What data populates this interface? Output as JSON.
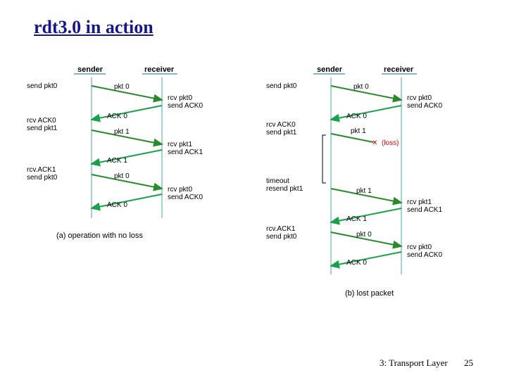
{
  "title": "rdt3.0 in action",
  "footer": {
    "section": "3: Transport Layer",
    "page": "25"
  },
  "diagram": {
    "headers": {
      "sender": "sender",
      "receiver": "receiver"
    },
    "a": {
      "caption": "(a) operation with no loss",
      "left": [
        "send pkt0",
        "rcv ACK0\nsend pkt1",
        "rcv.ACK1\nsend pkt0"
      ],
      "right": [
        "rcv pkt0\nsend ACK0",
        "rcv pkt1\nsend ACK1",
        "rcv pkt0\nsend ACK0"
      ],
      "arrows": [
        "pkt 0",
        "ACK 0",
        "pkt 1",
        "ACK 1",
        "pkt 0",
        "ACK 0"
      ]
    },
    "b": {
      "caption": "(b) lost packet",
      "loss_label": "(loss)",
      "left": [
        "send pkt0",
        "rcv ACK0\nsend pkt1",
        "timeout\nresend pkt1",
        "rcv.ACK1\nsend pkt0"
      ],
      "right": [
        "rcv pkt0\nsend ACK0",
        "rcv pkt1\nsend ACK1",
        "rcv pkt0\nsend ACK0"
      ],
      "arrows": [
        "pkt 0",
        "ACK 0",
        "pkt 1",
        "pkt 1",
        "ACK 1",
        "pkt 0",
        "ACK 0"
      ]
    }
  }
}
